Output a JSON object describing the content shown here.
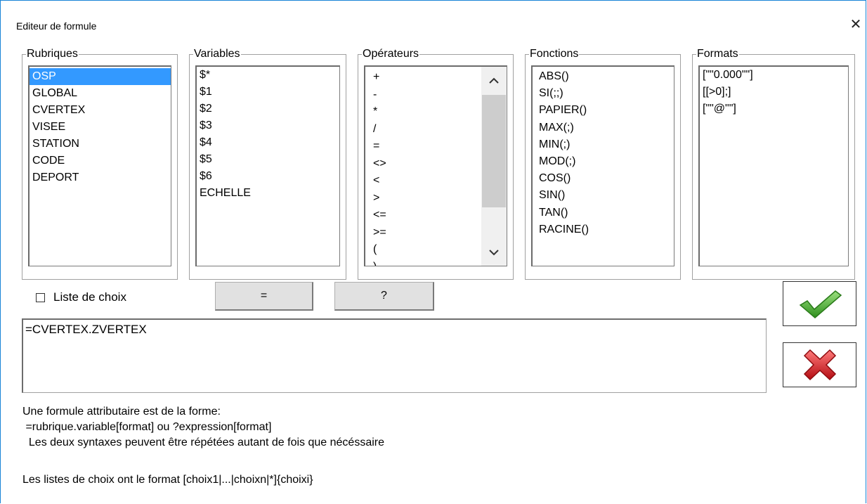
{
  "window": {
    "title": "Editeur de formule"
  },
  "rubriques": {
    "label": "Rubriques",
    "items": [
      "OSP",
      "GLOBAL",
      "CVERTEX",
      "VISEE",
      "STATION",
      "CODE",
      "DEPORT"
    ],
    "selected": "OSP"
  },
  "variables": {
    "label": "Variables",
    "items": [
      "$*",
      "$1",
      "$2",
      "$3",
      "$4",
      "$5",
      "$6",
      "ECHELLE"
    ]
  },
  "operateurs": {
    "label": "Opérateurs",
    "items": [
      "+",
      "-",
      "*",
      "/",
      "=",
      "<>",
      "<",
      ">",
      "<=",
      ">=",
      "(",
      ")"
    ]
  },
  "fonctions": {
    "label": "Fonctions",
    "items": [
      "ABS()",
      "SI(;;)",
      "PAPIER()",
      "MAX(;)",
      "MIN(;)",
      "MOD(;)",
      "COS()",
      "SIN()",
      "TAN()",
      "RACINE()"
    ]
  },
  "formats": {
    "label": "Formats",
    "items": [
      "[\"\"0.000\"\"]",
      "[[>0];]",
      "[\"\"@\"\"]"
    ]
  },
  "liste_de_choix": {
    "label": "Liste de choix",
    "checked": false
  },
  "buttons": {
    "equals": "=",
    "question": "?"
  },
  "formula": {
    "value": "=CVERTEX.ZVERTEX"
  },
  "help": {
    "line1": "Une formule attributaire est de la forme:",
    "line2": " =rubrique.variable[format] ou ?expression[format]",
    "line3": "  Les deux syntaxes peuvent être répétées autant de fois que nécéssaire",
    "line4": "Les listes de choix ont le format [choix1|...|choixn|*]{choixi}"
  },
  "colors": {
    "selection": "#3399ff",
    "ok": "#3fae2a",
    "cancel": "#d8232a"
  }
}
